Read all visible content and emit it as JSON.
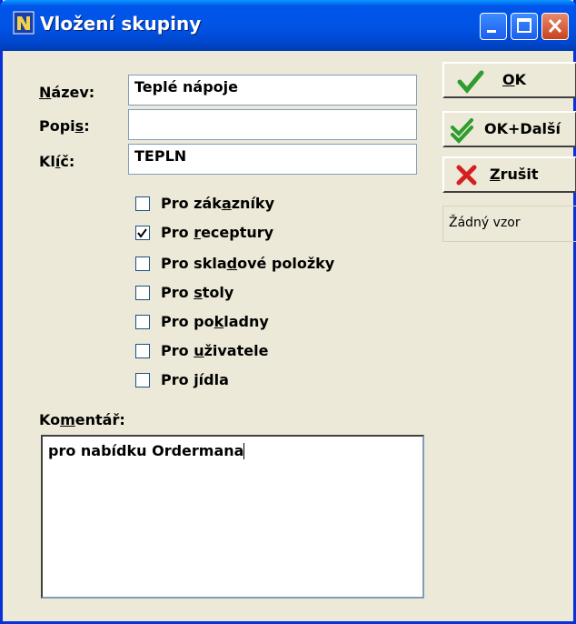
{
  "window": {
    "title": "Vložení skupiny"
  },
  "form": {
    "nazev_label_a": "N",
    "nazev_label_b": "ázev:",
    "nazev_value": "Teplé nápoje",
    "popis_label_a": "Popi",
    "popis_label_b": "s",
    "popis_label_c": ":",
    "popis_value": "",
    "klic_label_a": "Kl",
    "klic_label_b": "í",
    "klic_label_c": "č:",
    "klic_value": "TEPLN"
  },
  "checkboxes": [
    {
      "pre": "Pro zák",
      "acc": "a",
      "post": "zníky",
      "checked": false
    },
    {
      "pre": "Pro ",
      "acc": "r",
      "post": "eceptury",
      "checked": true
    },
    {
      "pre": "Pro skla",
      "acc": "d",
      "post": "ové položky",
      "checked": false
    },
    {
      "pre": "Pro ",
      "acc": "s",
      "post": "toly",
      "checked": false
    },
    {
      "pre": "Pro po",
      "acc": "k",
      "post": "ladny",
      "checked": false
    },
    {
      "pre": "Pro ",
      "acc": "u",
      "post": "živatele",
      "checked": false
    },
    {
      "pre": "Pro ",
      "acc": "j",
      "post": "ídla",
      "checked": false
    }
  ],
  "comment": {
    "label_a": "Ko",
    "label_b": "m",
    "label_c": "entář:",
    "value": "pro nabídku Ordermana"
  },
  "buttons": {
    "ok_a": "O",
    "ok_b": "K",
    "okdalsi": "OK+Další",
    "zrusit_a": "Z",
    "zrusit_b": "rušit",
    "no_pattern": "Žádný vzor"
  },
  "colors": {
    "titlebar": "#0055ea",
    "ok_check": "#2e9c2e",
    "cancel_x": "#d42020",
    "face": "#ece9d8"
  }
}
